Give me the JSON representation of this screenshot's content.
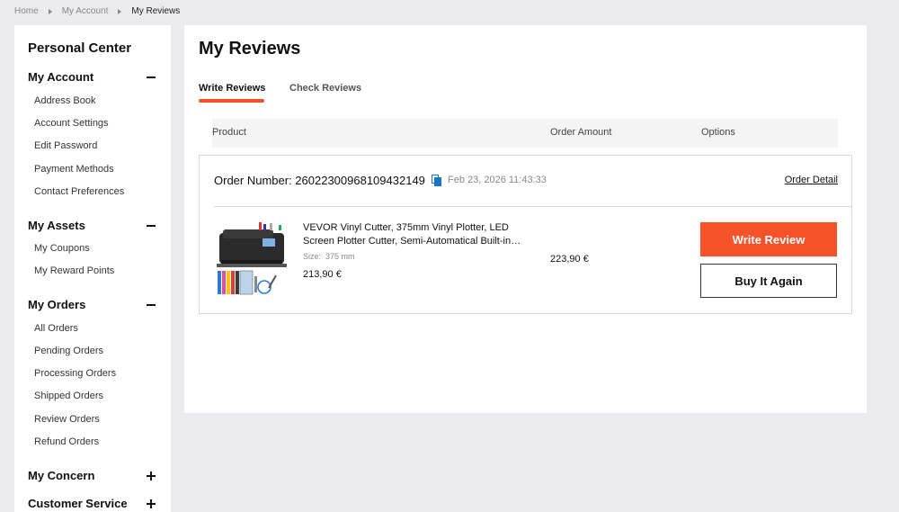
{
  "breadcrumb": {
    "home": "Home",
    "account": "My Account",
    "current": "My Reviews"
  },
  "sidebar": {
    "title": "Personal Center",
    "sections": [
      {
        "label": "My Account",
        "state": "expanded",
        "items": [
          "Address Book",
          "Account Settings",
          "Edit Password",
          "Payment Methods",
          "Contact Preferences"
        ]
      },
      {
        "label": "My Assets",
        "state": "expanded",
        "items": [
          "My Coupons",
          "My Reward Points"
        ]
      },
      {
        "label": "My Orders",
        "state": "expanded",
        "items": [
          "All Orders",
          "Pending Orders",
          "Processing Orders",
          "Shipped Orders",
          "Review Orders",
          "Refund Orders"
        ]
      },
      {
        "label": "My Concern",
        "state": "collapsed",
        "items": []
      },
      {
        "label": "Customer Service",
        "state": "collapsed",
        "items": []
      }
    ]
  },
  "main": {
    "title": "My Reviews",
    "tabs": [
      {
        "label": "Write Reviews",
        "active": true
      },
      {
        "label": "Check Reviews",
        "active": false
      }
    ],
    "table_headers": [
      "Product",
      "Order Amount",
      "Options"
    ],
    "order": {
      "number_label": "Order Number: 26022300968109432149",
      "time": "Feb 23, 2026 11:43:33",
      "detail_link": "Order Detail",
      "product": {
        "name": "VEVOR Vinyl Cutter, 375mm Vinyl Plotter, LED Screen Plotter Cutter, Semi-Automatical Built-in Optical Eye Vinyl Cutting Machine",
        "size_label": "Size:",
        "size_value": "375 mm",
        "price": "213,90 €"
      },
      "amount": "223,90 €",
      "write_review_label": "Write Review",
      "buy_again_label": "Buy It Again"
    }
  },
  "colors": {
    "accent": "#f5522a",
    "copy_icon": "#1a73c8",
    "page_bg": "#ebebef"
  }
}
